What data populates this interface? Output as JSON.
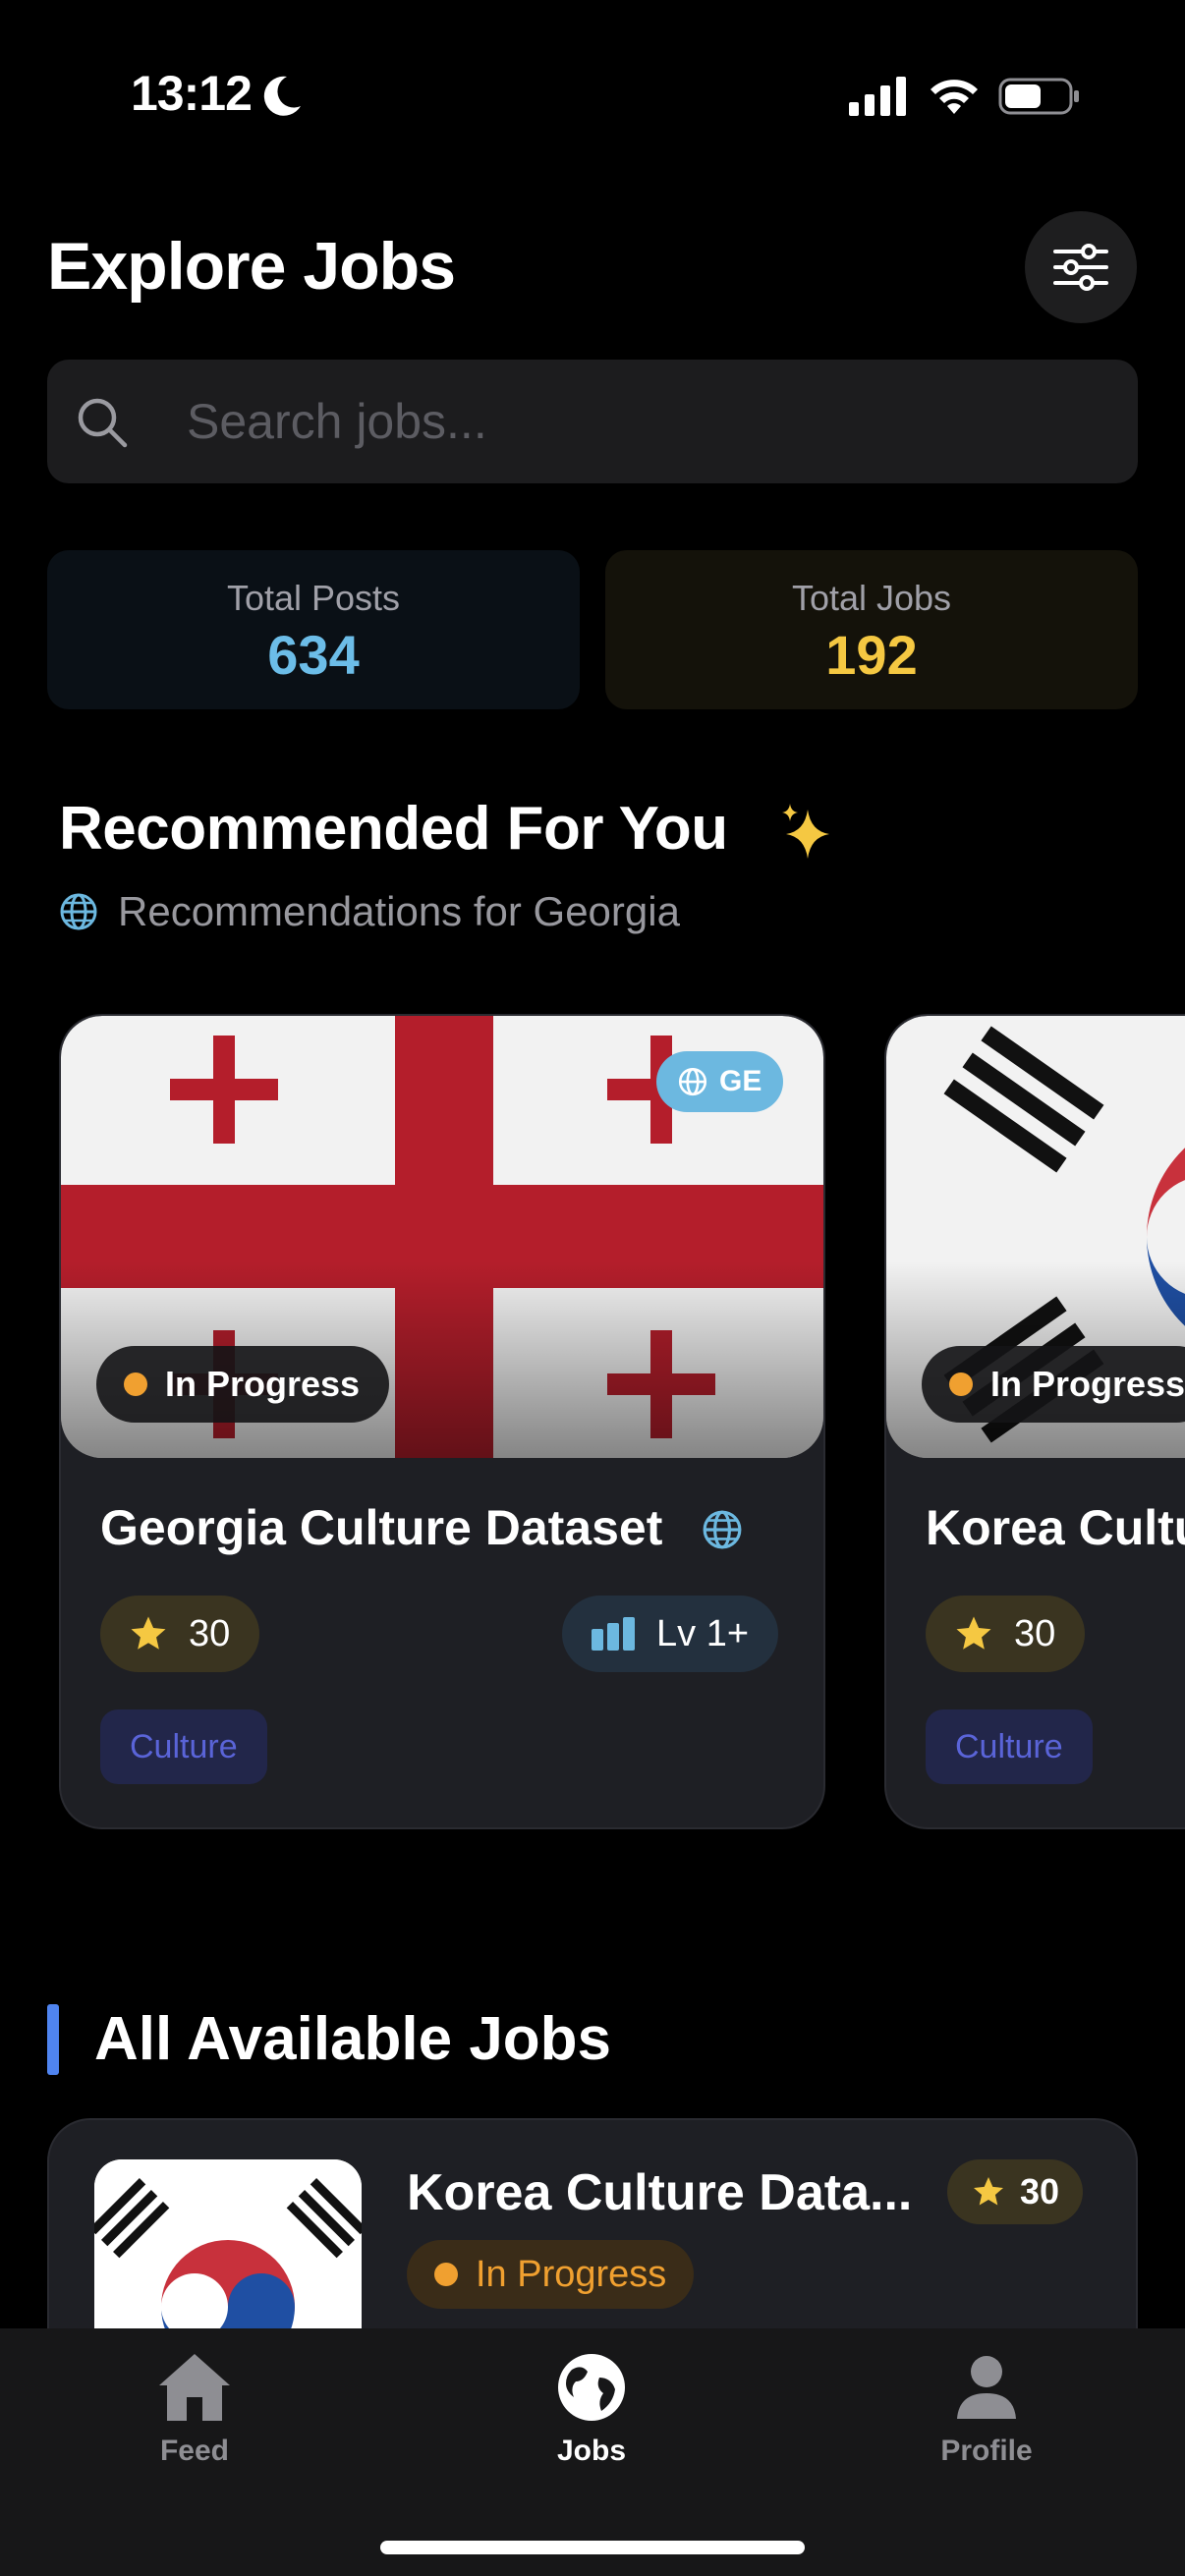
{
  "status_bar": {
    "time": "13:12"
  },
  "header": {
    "title": "Explore Jobs"
  },
  "search": {
    "placeholder": "Search jobs..."
  },
  "stats": {
    "posts": {
      "label": "Total Posts",
      "value": "634",
      "color": "#6cbde8"
    },
    "jobs": {
      "label": "Total Jobs",
      "value": "192",
      "color": "#f5c842"
    }
  },
  "recommended": {
    "title": "Recommended For You",
    "subtitle": "Recommendations for Georgia",
    "cards": [
      {
        "title": "Georgia Culture Dataset",
        "country_code": "GE",
        "status": "In Progress",
        "points": "30",
        "level": "Lv 1+",
        "tag": "Culture",
        "flag": "georgia"
      },
      {
        "title": "Korea Cultu",
        "status": "In Progress",
        "points": "30",
        "tag": "Culture",
        "flag": "korea"
      }
    ]
  },
  "all_jobs": {
    "title": "All Available Jobs",
    "items": [
      {
        "title": "Korea Culture Data...",
        "status": "In Progress",
        "points": "30",
        "flag": "korea"
      }
    ]
  },
  "tab_bar": {
    "active": "jobs",
    "tabs": [
      {
        "id": "feed",
        "label": "Feed",
        "icon": "home-icon"
      },
      {
        "id": "jobs",
        "label": "Jobs",
        "icon": "globe-icon"
      },
      {
        "id": "profile",
        "label": "Profile",
        "icon": "person-icon"
      }
    ]
  },
  "colors": {
    "accent_blue": "#4f84f0",
    "status_orange": "#f0a030",
    "star_yellow": "#f5c842",
    "tag_text": "#5a64d8"
  }
}
